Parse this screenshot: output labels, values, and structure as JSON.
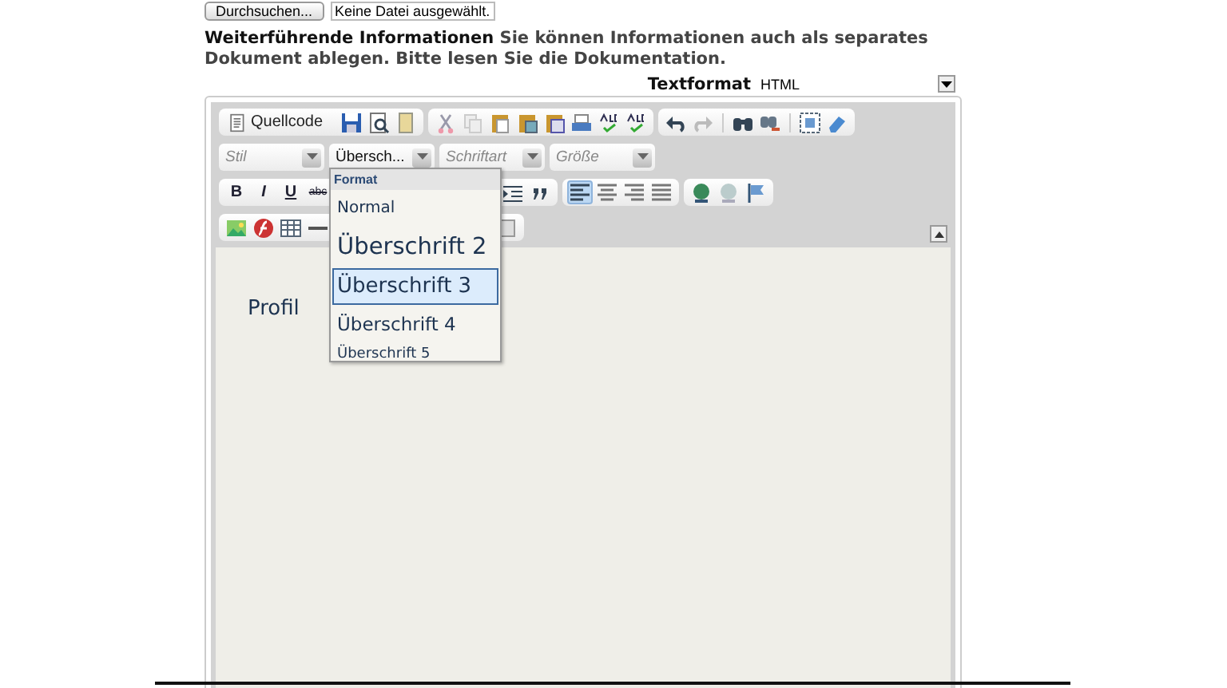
{
  "file_upload": {
    "button": "Durchsuchen...",
    "status": "Keine Datei ausgewählt."
  },
  "intro": {
    "title": "Weiterführende Informationen",
    "text": "Sie können Informationen auch als separates Dokument ablegen. Bitte lesen Sie die Dokumentation."
  },
  "text_format": {
    "label": "Textformat",
    "value": "HTML"
  },
  "toolbar": {
    "source_button": "Quellcode",
    "combos": [
      {
        "placeholder": "Stil"
      },
      {
        "value": "Übersch..."
      },
      {
        "placeholder": "Schriftart"
      },
      {
        "placeholder": "Größe"
      }
    ],
    "format_buttons": [
      "B",
      "I",
      "U",
      "abc"
    ],
    "alignment": [
      {
        "selected": true
      },
      {
        "selected": false
      },
      {
        "selected": false
      },
      {
        "selected": false
      }
    ]
  },
  "format_menu": {
    "title": "Format",
    "items": [
      {
        "label": "Normal",
        "selected": false,
        "kind": "normal"
      },
      {
        "label": "Überschrift 2",
        "selected": false,
        "kind": "h2"
      },
      {
        "label": "Überschrift 3",
        "selected": true,
        "kind": "h3"
      },
      {
        "label": "Überschrift 4",
        "selected": false,
        "kind": "h4"
      },
      {
        "label": "Überschrift 5",
        "selected": false,
        "kind": "h5"
      }
    ]
  },
  "content": {
    "text": "Profil"
  }
}
